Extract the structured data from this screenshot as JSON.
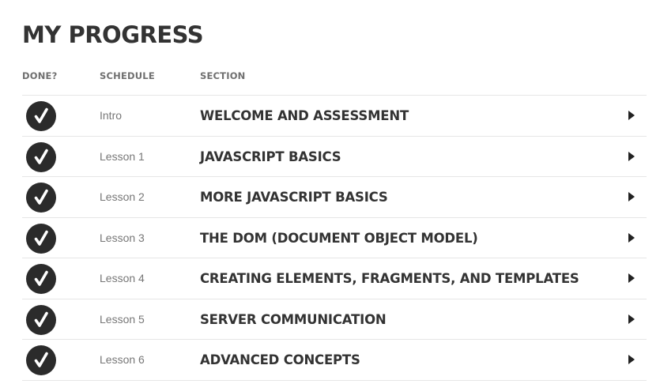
{
  "page": {
    "title": "MY PROGRESS"
  },
  "columns": {
    "done": "DONE?",
    "schedule": "SCHEDULE",
    "section": "SECTION"
  },
  "rows": [
    {
      "schedule": "Intro",
      "title": "WELCOME AND ASSESSMENT",
      "done": true,
      "icon": "checkmark-icon"
    },
    {
      "schedule": "Lesson 1",
      "title": "JAVASCRIPT BASICS",
      "done": true,
      "icon": "checkmark-icon"
    },
    {
      "schedule": "Lesson 2",
      "title": "MORE JAVASCRIPT BASICS",
      "done": true,
      "icon": "checkmark-icon"
    },
    {
      "schedule": "Lesson 3",
      "title": "THE DOM (DOCUMENT OBJECT MODEL)",
      "done": true,
      "icon": "checkmark-icon"
    },
    {
      "schedule": "Lesson 4",
      "title": "CREATING ELEMENTS, FRAGMENTS, AND TEMPLATES",
      "done": true,
      "icon": "checkmark-icon"
    },
    {
      "schedule": "Lesson 5",
      "title": "SERVER COMMUNICATION",
      "done": true,
      "icon": "checkmark-icon"
    },
    {
      "schedule": "Lesson 6",
      "title": "ADVANCED CONCEPTS",
      "done": true,
      "icon": "checkmark-icon"
    }
  ],
  "colors": {
    "text": "#333333",
    "muted": "#777777",
    "check_bg": "#2b2b2b",
    "divider": "#e6e6e6"
  }
}
